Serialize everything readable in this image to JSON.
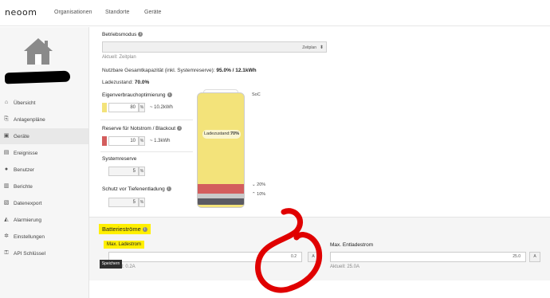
{
  "brand": {
    "logo": "neoom"
  },
  "nav": {
    "items": [
      "Organisationen",
      "Standorte",
      "Geräte"
    ]
  },
  "sidebar": {
    "items": [
      {
        "label": "Übersicht",
        "icon": "home-icon"
      },
      {
        "label": "Anlagenpläne",
        "icon": "plan-icon"
      },
      {
        "label": "Geräte",
        "icon": "device-icon"
      },
      {
        "label": "Ereignisse",
        "icon": "events-icon"
      },
      {
        "label": "Benutzer",
        "icon": "user-icon"
      },
      {
        "label": "Berichte",
        "icon": "report-icon"
      },
      {
        "label": "Datenexport",
        "icon": "export-icon"
      },
      {
        "label": "Alarmierung",
        "icon": "alarm-icon"
      },
      {
        "label": "Einstellungen",
        "icon": "gear-icon"
      },
      {
        "label": "API Schlüssel",
        "icon": "key-icon"
      }
    ],
    "active_index": 2
  },
  "betriebsmodus": {
    "label": "Betriebsmodus",
    "selected": "Zeitplan",
    "current": "Aktuell: Zeitplan"
  },
  "capacity": {
    "prefix": "Nutzbare Gesamtkapazität (inkl. Systemreserve):",
    "value": "95.0% / 12.1kWh"
  },
  "charge_state": {
    "prefix": "Ladezustand:",
    "value": "70.0%"
  },
  "settings": {
    "self_consumption": {
      "label": "Eigenverbrauchoptimierung",
      "value": "80",
      "unit": "%",
      "approx": "~ 10.2kWh",
      "color": "#f3e37a"
    },
    "emergency_reserve": {
      "label": "Reserve für Notstrom / Blackout",
      "value": "10",
      "unit": "%",
      "approx": "~ 1.3kWh",
      "color": "#d35d5d"
    },
    "system_reserve": {
      "label": "Systemreserve",
      "value": "5",
      "unit": "%"
    },
    "deep_discharge": {
      "label": "Schutz vor Tiefenentladung",
      "value": "5",
      "unit": "%"
    }
  },
  "battery": {
    "label_prefix": "Ladezustand:",
    "label_value": "70%",
    "soc_label": "SoC",
    "marker_20": "20%",
    "marker_10": "10%"
  },
  "currents": {
    "title": "Batterieströme",
    "charge": {
      "label": "Max. Ladestrom",
      "value": "0.2",
      "unit": "A",
      "current": "Aktuell: 0.2A"
    },
    "discharge": {
      "label": "Max. Entladestrom",
      "value": "25.0",
      "unit": "A",
      "current": "Aktuell: 25.0A"
    }
  },
  "save_label": "Speichern",
  "colors": {
    "highlight": "#ffef00",
    "annotation": "#e00000"
  }
}
